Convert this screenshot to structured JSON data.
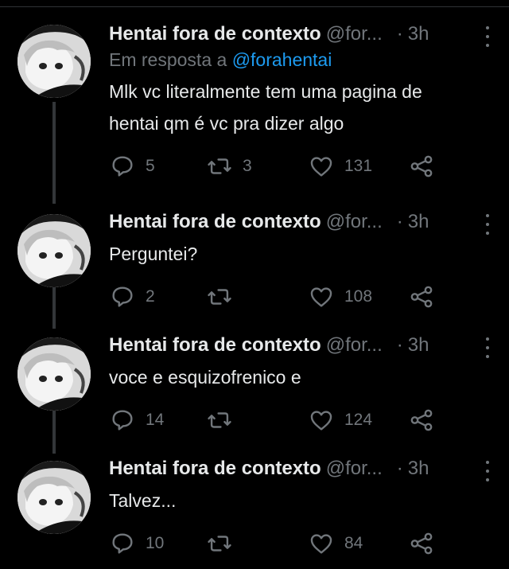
{
  "tweets": [
    {
      "name": "Hentai fora de contexto",
      "handle": "@for...",
      "time": "3h",
      "reply_prefix": "Em resposta a",
      "reply_handle": "@forahentai",
      "text_lines": [
        "Mlk vc literalmente tem uma pagina de",
        "hentai qm é vc pra dizer algo"
      ],
      "replies": "5",
      "retweets": "3",
      "likes": "131"
    },
    {
      "name": "Hentai fora de contexto",
      "handle": "@for...",
      "time": "3h",
      "text_lines": [
        "Perguntei?"
      ],
      "replies": "2",
      "retweets": "",
      "likes": "108"
    },
    {
      "name": "Hentai fora de contexto",
      "handle": "@for...",
      "time": "3h",
      "text_lines": [
        "voce e esquizofrenico e"
      ],
      "replies": "14",
      "retweets": "",
      "likes": "124"
    },
    {
      "name": "Hentai fora de contexto",
      "handle": "@for...",
      "time": "3h",
      "text_lines": [
        "Talvez..."
      ],
      "replies": "10",
      "retweets": "",
      "likes": "84"
    }
  ],
  "separator": "·",
  "colors": {
    "background": "#000000",
    "text": "#e7e9ea",
    "muted": "#71767b",
    "link": "#1d9bf0"
  },
  "icons": [
    "reply-icon",
    "retweet-icon",
    "like-icon",
    "share-icon",
    "more-icon"
  ]
}
